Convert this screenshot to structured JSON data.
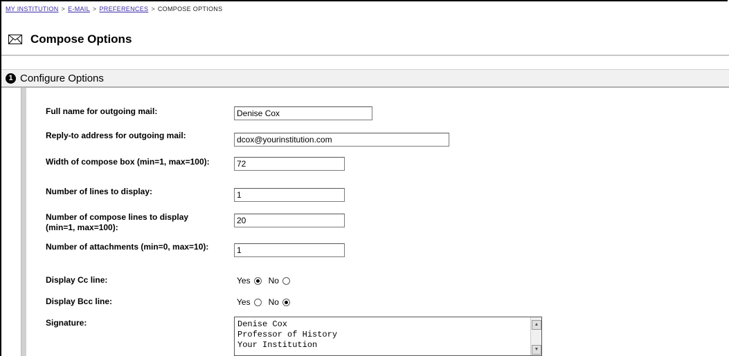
{
  "breadcrumb": {
    "item1": "MY INSTITUTION",
    "item2": "E-MAIL",
    "item3": "PREFERENCES",
    "item4": "COMPOSE OPTIONS",
    "separator": ">"
  },
  "page": {
    "title": "Compose Options",
    "icon": "envelope-icon"
  },
  "section": {
    "number": "1",
    "title": "Configure Options"
  },
  "fields": {
    "full_name": {
      "label": "Full name for outgoing mail:",
      "value": "Denise Cox"
    },
    "reply_to": {
      "label": "Reply-to address for outgoing mail:",
      "value": "dcox@yourinstitution.com"
    },
    "width": {
      "label": "Width of compose box (min=1, max=100):",
      "value": "72"
    },
    "lines": {
      "label": "Number of lines to display:",
      "value": "1"
    },
    "compose_lines": {
      "label": "Number of compose lines to display (min=1, max=100):",
      "value": "20"
    },
    "attachments": {
      "label": "Number of attachments (min=0, max=10):",
      "value": "1"
    },
    "cc": {
      "label": "Display Cc line:",
      "yes": "Yes",
      "no": "No",
      "selected": "Yes"
    },
    "bcc": {
      "label": "Display Bcc line:",
      "yes": "Yes",
      "no": "No",
      "selected": "No"
    },
    "signature": {
      "label": "Signature:",
      "value": "Denise Cox\nProfessor of History\nYour Institution"
    }
  }
}
